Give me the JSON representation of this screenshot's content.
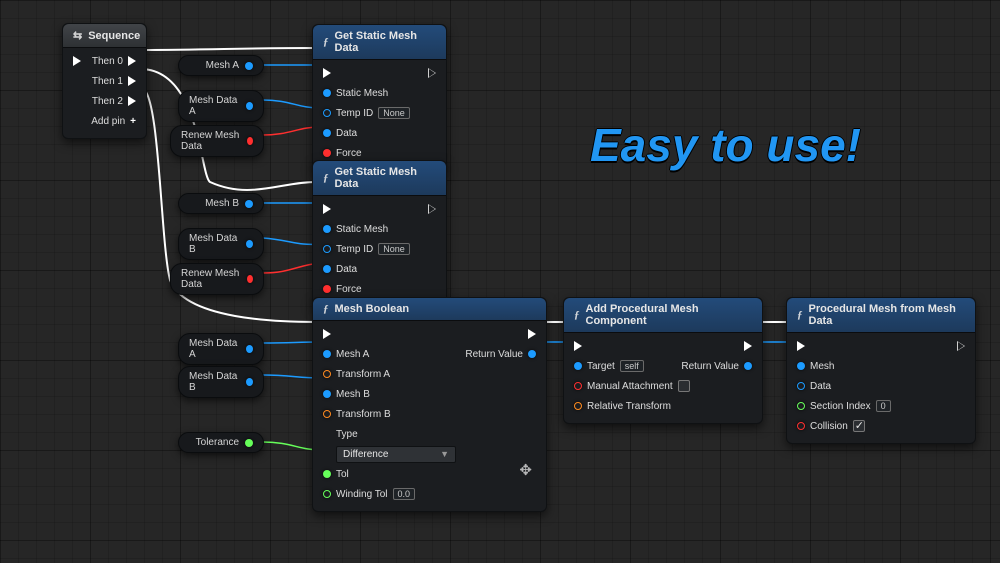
{
  "titleText": "Easy to use!",
  "pills": {
    "meshA1": "Mesh A",
    "meshDataA1": "Mesh Data A",
    "renewA": "Renew Mesh Data",
    "meshB1": "Mesh B",
    "meshDataB1": "Mesh Data B",
    "renewB": "Renew Mesh Data",
    "meshDataA2": "Mesh Data A",
    "meshDataB2": "Mesh Data B",
    "tolerance": "Tolerance"
  },
  "sequence": {
    "title": "Sequence",
    "pins": [
      "Then 0",
      "Then 1",
      "Then 2"
    ],
    "add": "Add pin"
  },
  "getMesh": {
    "title": "Get Static Mesh Data",
    "staticMesh": "Static Mesh",
    "tempId": "Temp ID",
    "tempIdVal": "None",
    "data": "Data",
    "force": "Force"
  },
  "meshBool": {
    "title": "Mesh Boolean",
    "meshA": "Mesh A",
    "transformA": "Transform A",
    "meshB": "Mesh B",
    "transformB": "Transform B",
    "type": "Type",
    "typeVal": "Difference",
    "tol": "Tol",
    "winding": "Winding Tol",
    "windingVal": "0.0",
    "ret": "Return Value"
  },
  "addProc": {
    "title": "Add Procedural Mesh Component",
    "target": "Target",
    "targetVal": "self",
    "manual": "Manual Attachment",
    "relative": "Relative Transform",
    "ret": "Return Value"
  },
  "procMesh": {
    "title": "Procedural Mesh from Mesh Data",
    "mesh": "Mesh",
    "data": "Data",
    "section": "Section Index",
    "sectionVal": "0",
    "collision": "Collision"
  }
}
